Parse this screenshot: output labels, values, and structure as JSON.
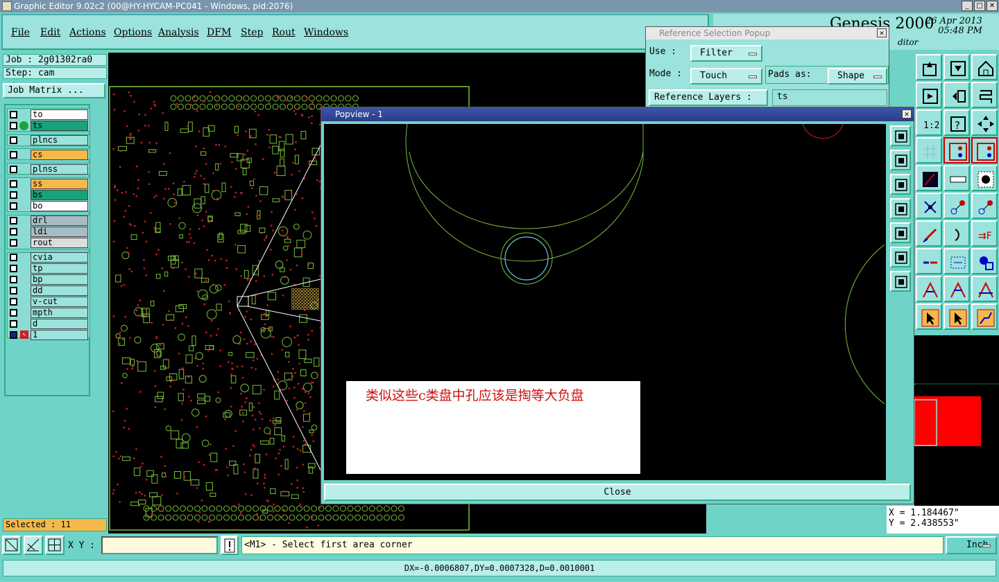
{
  "window": {
    "title": "Graphic Editor 9.02c2 (00@HY-HYCAM-PC041 - Windows, pid:2076)"
  },
  "menu": [
    "File",
    "Edit",
    "Actions",
    "Options",
    "Analysis",
    "DFM",
    "Step",
    "Rout",
    "Windows"
  ],
  "brand": {
    "name": "Genesis 2000",
    "date": "26 Apr 2013",
    "time": "05:48 PM",
    "subtitle": "ditor"
  },
  "left": {
    "job": "Job : 2g01302ra0",
    "step": "Step: cam",
    "job_matrix": "Job Matrix ...",
    "selected": "Selected : 11",
    "layers": [
      {
        "name": "to",
        "color": "#ffffff"
      },
      {
        "name": "ts",
        "color": "#17a27a"
      },
      {
        "name": "plncs",
        "color": "#9be3dc"
      },
      {
        "name": "cs",
        "color": "#f5b84b"
      },
      {
        "name": "plnss",
        "color": "#9be3dc"
      },
      {
        "name": "ss",
        "color": "#f5b84b"
      },
      {
        "name": "bs",
        "color": "#17a27a"
      },
      {
        "name": "bo",
        "color": "#ffffff"
      },
      {
        "name": "drl",
        "color": "#a8bcc4"
      },
      {
        "name": "ldi",
        "color": "#a8bcc4"
      },
      {
        "name": "rout",
        "color": "#dcdcdc"
      },
      {
        "name": "cvia",
        "color": "#9be3dc"
      },
      {
        "name": "tp",
        "color": "#9be3dc"
      },
      {
        "name": "bp",
        "color": "#9be3dc"
      },
      {
        "name": "dd",
        "color": "#9be3dc"
      },
      {
        "name": "v-cut",
        "color": "#9be3dc"
      },
      {
        "name": "mpth",
        "color": "#9be3dc"
      },
      {
        "name": "d",
        "color": "#9be3dc"
      },
      {
        "name": "1",
        "color": "#9be3dc"
      }
    ]
  },
  "ref_popup": {
    "title": "Reference Selection Popup",
    "use_label": "Use  :",
    "use_value": "Filter",
    "mode_label": "Mode :",
    "mode_value": "Touch",
    "pads_label": "Pads as:",
    "pads_value": "Shape",
    "ref_layers_label": "Reference Layers :",
    "ref_layers_value": "ts"
  },
  "popview": {
    "title": "Popview - 1",
    "annotation": "类似这些c类盘中孔应该是掏等大负盘",
    "close_label": "Close"
  },
  "coords": {
    "x": "X = 1.184467\"",
    "y": "Y = 2.438553\""
  },
  "bottom": {
    "xy_label": "X Y :",
    "xy_value": "",
    "status": "<M1> - Select first area corner",
    "unit": "Inch",
    "measure": "DX=-0.0006807,DY=0.0007328,D=0.0010001"
  },
  "colors": {
    "teal_bg": "#6fd3c8",
    "panel": "#9be3dc",
    "pcb_red": "#d21e1e",
    "pcb_green": "#7bbf3c"
  }
}
